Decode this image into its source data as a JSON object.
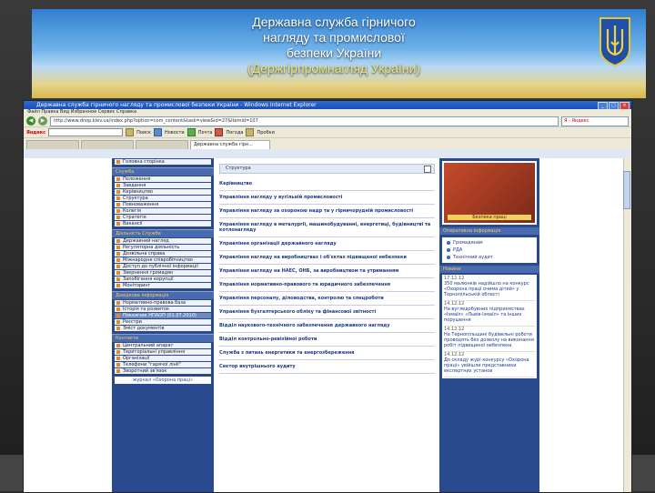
{
  "banner": {
    "line1": "Державна служба гірничого",
    "line2": "нагляду та промислової",
    "line3": "безпеки України",
    "line4": "(Держгірпромнагляд України)"
  },
  "browser": {
    "title": "Державна служба гірничого нагляду та промислової безпеки України - Windows Internet Explorer",
    "menu": "Файл  Правка  Вид  Избранное  Сервис  Справка",
    "address": "http://www.dnop.kiev.ua/index.php?option=com_content&task=view&id=27&Itemid=107",
    "search_engine": "Я - Яндекс",
    "toolbar_label": "Яндекс",
    "toolbar_items": [
      "Поиск",
      "Новости",
      "Почта",
      "Погода",
      "Пробки"
    ],
    "tabs": [
      "",
      "",
      "",
      "Державна служба гірн..."
    ]
  },
  "left_sidebar": {
    "top_item": "Головна сторінка",
    "section1": "Служба",
    "items1": [
      "Положення",
      "Завдання",
      "Керівництво",
      "Структура",
      "Повноваження",
      "Колегія",
      "Стратегія",
      "Вакансії"
    ],
    "section2": "Діяльність Служби",
    "items2": [
      "Державний нагляд",
      "Регуляторна діяльність",
      "Дозвільна справа",
      "Міжнародне співробітництво",
      "Доступ до публічної інформації",
      "Звернення громадян",
      "Запобігання корупції",
      "Моніторинг"
    ],
    "section3": "Довідкова інформація",
    "items3": [
      "Нормативно-правова база",
      "Історія та розвиток",
      "Покажчик НПАОП (01.07.2010)",
      "Реєстри",
      "Зміст документів"
    ],
    "section4": "Контакти",
    "items4": [
      "Центральний апарат",
      "Територіальні управління",
      "Організації",
      "Телефони \"гарячої лінії\"",
      "Зворотний зв'язок"
    ],
    "bottom": "журнал «Охорона праці»"
  },
  "main": {
    "heading": "Структура",
    "links": [
      "Керівництво",
      "Управління нагляду у вугільній промисловості",
      "Управління нагляду за охороною надр та у гірничорудній промисловості",
      "Управління нагляду в металургії, машинобудуванні, енергетиці, будівництві та котлонагляду",
      "Управління організації державного нагляду",
      "Управління нагляду на виробництвах і об'єктах підвищеної небезпеки",
      "Управління нагляду на НАЕС, ОНБ, за виробництвом та утриманням",
      "Управління нормативно-правового та юридичного забезпечення",
      "Управління персоналу, діловодства, контролю та спецроботи",
      "Управління бухгалтерського обліку та фінансової звітності",
      "Відділ наукового-технічного забезпечення державного нагляду",
      "Відділ контрольно-ревізійної роботи",
      "Служба з питань енергетики та енергозбереження",
      "Сектор внутрішнього аудиту"
    ]
  },
  "right_sidebar": {
    "book_label": "Безпека праці",
    "section_info": "Оперативна інформація",
    "info_rows": [
      "Громадянам",
      "РДА",
      "Технічний аудит"
    ],
    "section_news": "Новини",
    "news": [
      {
        "date": "17.12.12",
        "text": "350 малюнків надійшло на конкурс «Охорона праці очима дітей» у Тернопільській області"
      },
      {
        "date": "14.12.12",
        "text": "На вугледобувних підприємствах «Ізмаїл» «Львів-Ізмаїл» та інших порушення"
      },
      {
        "date": "14.12.12",
        "text": "На Тернопільщині будівельні роботи проводять без дозволу на виконання робіт підвищеної небезпеки"
      },
      {
        "date": "14.12.12",
        "text": "До складу журі конкурсу «Охорона праці» увійшли представники експертних установ"
      }
    ]
  }
}
